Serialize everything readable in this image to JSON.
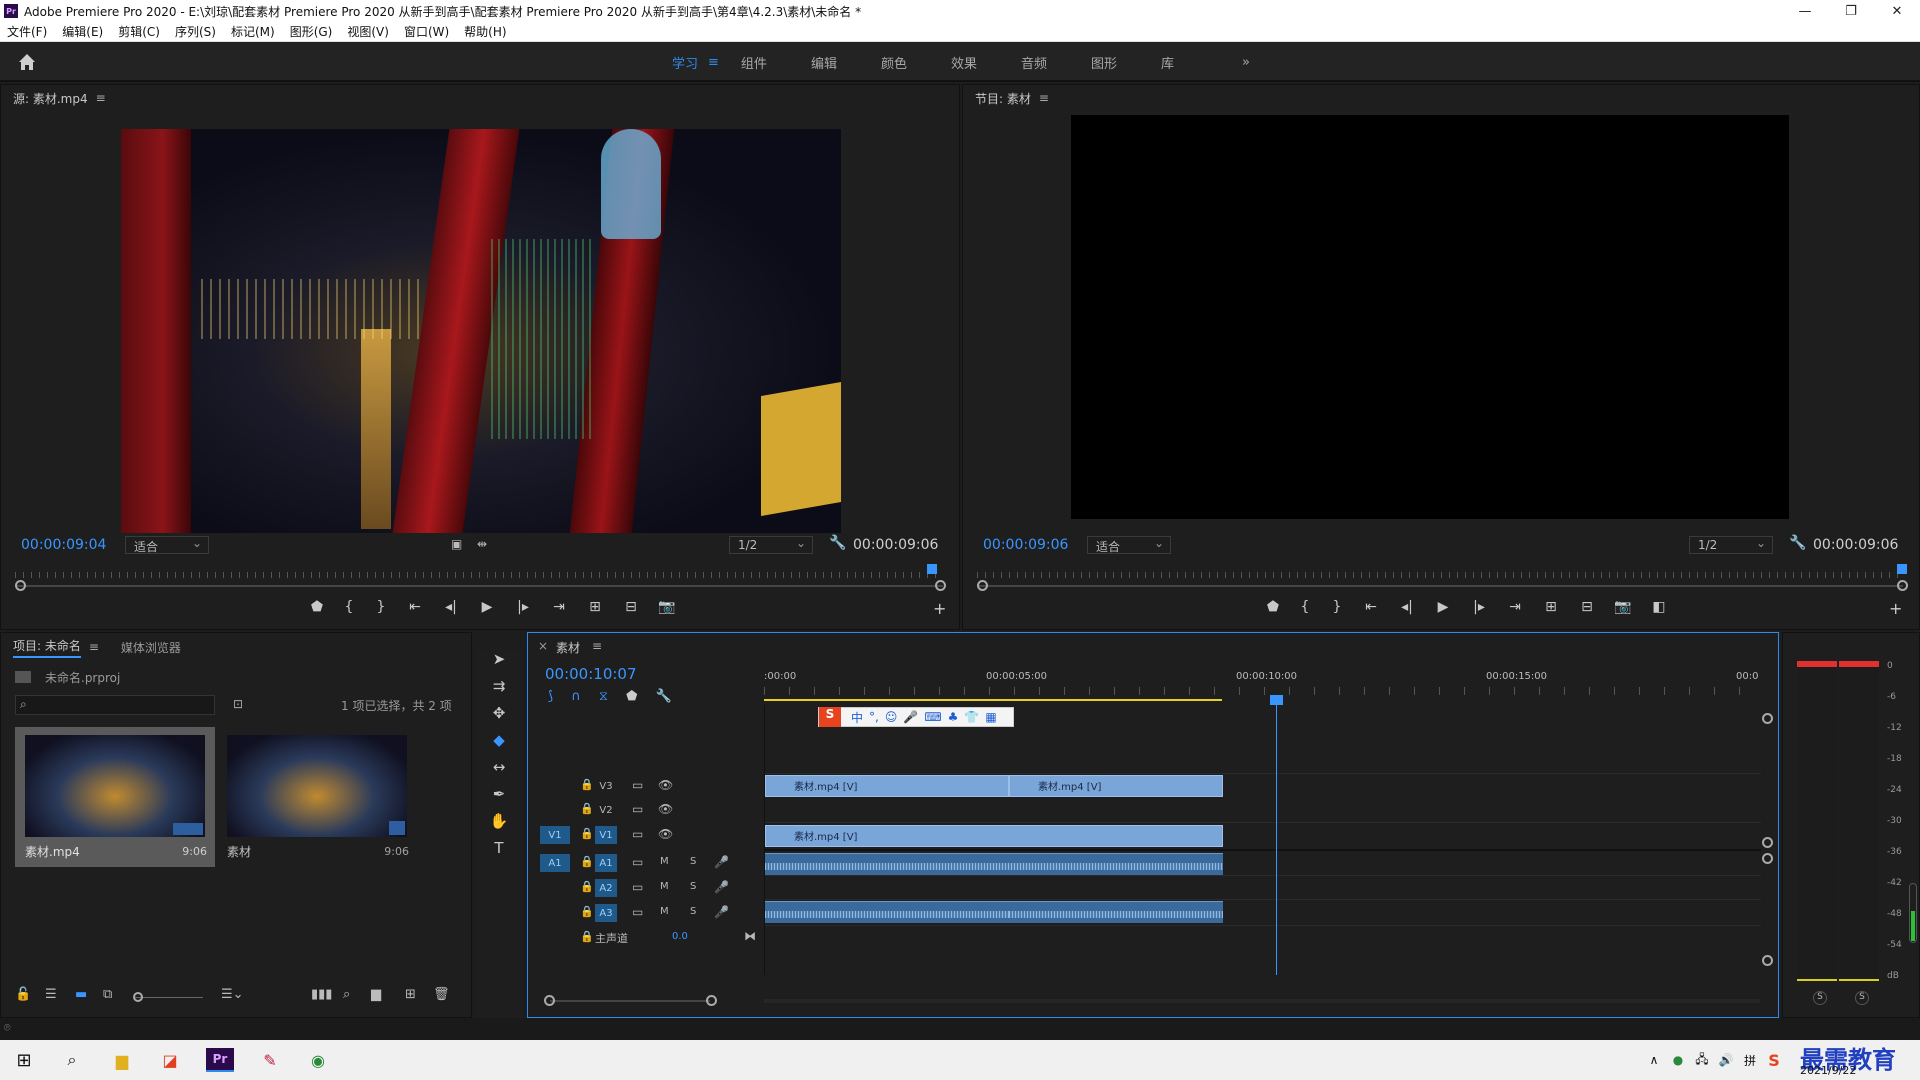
{
  "window": {
    "app_icon_label": "Pr",
    "title": "Adobe Premiere Pro 2020 - E:\\刘琼\\配套素材 Premiere Pro 2020 从新手到高手\\配套素材 Premiere Pro 2020 从新手到高手\\第4章\\4.2.3\\素材\\未命名 *",
    "minimize": "—",
    "maximize": "❐",
    "close": "✕"
  },
  "menu": [
    "文件(F)",
    "编辑(E)",
    "剪辑(C)",
    "序列(S)",
    "标记(M)",
    "图形(G)",
    "视图(V)",
    "窗口(W)",
    "帮助(H)"
  ],
  "workspaces": {
    "home_icon": "home-icon",
    "tabs": [
      "学习",
      "组件",
      "编辑",
      "颜色",
      "效果",
      "音频",
      "图形",
      "库"
    ],
    "active_index": 0,
    "overflow": "»"
  },
  "source_monitor": {
    "title": "源: 素材.mp4",
    "timecode": "00:00:09:04",
    "fit": "适合",
    "resolution": "1/2",
    "duration": "00:00:09:06"
  },
  "program_monitor": {
    "title": "节目: 素材",
    "timecode": "00:00:09:06",
    "fit": "适合",
    "resolution": "1/2",
    "duration": "00:00:09:06"
  },
  "project": {
    "tab_project": "项目: 未命名",
    "tab_media": "媒体浏览器",
    "file": "未命名.prproj",
    "selection": "1 项已选择，共 2 项",
    "items": [
      {
        "name": "素材.mp4",
        "duration": "9:06"
      },
      {
        "name": "素材",
        "duration": "9:06"
      }
    ]
  },
  "timeline": {
    "close": "×",
    "title": "素材",
    "timecode": "00:00:10:07",
    "ruler": [
      ":00:00",
      "00:00:05:00",
      "00:00:10:00",
      "00:00:15:00",
      "00:0"
    ],
    "video_tracks": [
      "V3",
      "V2",
      "V1"
    ],
    "audio_tracks": [
      "A1",
      "A2",
      "A3"
    ],
    "source_v": "V1",
    "source_a": "A1",
    "mute": "M",
    "solo": "S",
    "master_label": "主声道",
    "master_value": "0.0",
    "clips": {
      "v3_a": "素材.mp4 [V]",
      "v3_b": "素材.mp4 [V]",
      "v1": "素材.mp4 [V]"
    }
  },
  "meter": {
    "scale": [
      "0",
      "-6",
      "-12",
      "-18",
      "-24",
      "-30",
      "-36",
      "-42",
      "-48",
      "-54",
      "dB"
    ],
    "solo_left": "S",
    "solo_right": "S"
  },
  "ime_toolbar": [
    "中",
    "°,",
    "☺",
    "🎤",
    "⌨",
    "♣",
    "👕",
    "▦"
  ],
  "taskbar": {
    "date": "2021/9/22",
    "watermark": "最需教育"
  }
}
